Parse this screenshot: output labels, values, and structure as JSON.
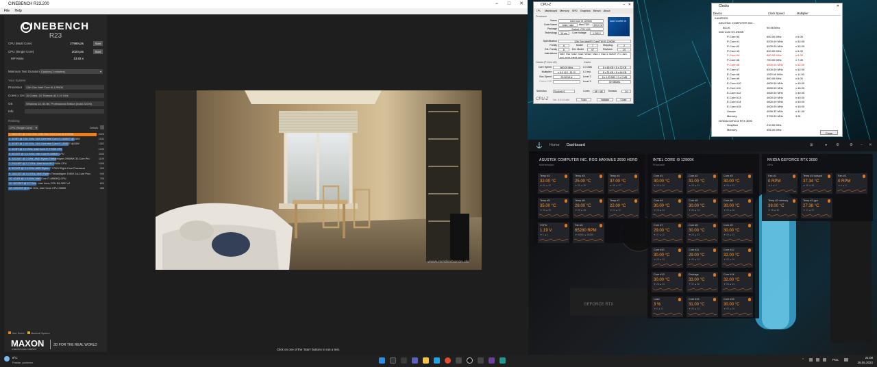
{
  "cinebench": {
    "window_title": "CINEBENCH R23.200",
    "menu": [
      "File",
      "Help"
    ],
    "logo_line1": "CINEBENCH",
    "logo_line2": "R23",
    "multi_label": "CPU (Multi Core)",
    "multi_value": "27989 pts",
    "single_label": "CPU (Single Core)",
    "single_value": "2023 pts",
    "mp_label": "MP Ratio",
    "mp_value": "13.83 x",
    "start_label": "Start",
    "min_test_label": "Minimum Test Duration",
    "min_test_value": "Custom (1 minutes)",
    "your_system": "Your System",
    "processor_label": "Processor",
    "processor_value": "12th Gen Intel Core i9-12900K",
    "cores_label": "Cores x GHz",
    "cores_value": "16 Cores, 24 Threads @ 3.19 GHz",
    "os_label": "OS",
    "os_value": "Windows 10, 64 Bit, Professional Edition (build 22000)",
    "info_label": "Info",
    "ranking_label": "Ranking",
    "ranking_select": "CPU (Single Core)",
    "details_label": "Details",
    "ranking": [
      {
        "text": "1. 16C/24T @ 3.19 GHz, 12th Gen Intel Core i9-12900K",
        "score": "2023",
        "pct": 100,
        "hi": true
      },
      {
        "text": "2. 4C/8T @ 2.61 GHz, 11th Gen Intel Core i7-1165G7 @ 28W",
        "score": "1532",
        "pct": 75
      },
      {
        "text": "3. 4C/8T @ 1.69 GHz, 11th Gen Intel Core i7-1165G7 @15W",
        "score": "1382",
        "pct": 68
      },
      {
        "text": "4. 4C/8T @ 4.2 GHz, Intel Core i7-7700K CPU",
        "score": "1230",
        "pct": 61
      },
      {
        "text": "5. 8C/16T @ 2.3 GHz, Intel Core i9-9880H CPU",
        "score": "1183",
        "pct": 58
      },
      {
        "text": "6. 32C/64T @ 3 GHz, AMD Ryzen Threadripper 2990WX 32-Core Pro",
        "score": "1109",
        "pct": 54
      },
      {
        "text": "7. 24C/48T @ 2.7 GHz, Intel Xeon W-2265M CPU",
        "score": "1058",
        "pct": 52
      },
      {
        "text": "8. 8C/16T @ 3.4 GHz, AMD Ryzen 7 1700X Eight-Core Processor",
        "score": "959",
        "pct": 47
      },
      {
        "text": "9. 16C/32T @ 3.4 GHz, AMD Ryzen Threadripper 1950X 16-Core Proc",
        "score": "945",
        "pct": 46
      },
      {
        "text": "10. 4C/8T @ 2.3 GHz, Intel Core i7-4850HQ CPU",
        "score": "750",
        "pct": 37
      },
      {
        "text": "11. 12C/24T @ 2.7 GHz, Intel Xeon CPU E5-2697 v2",
        "score": "653",
        "pct": 32
      },
      {
        "text": "12. 12C/24T @ 2.66 GHz, Intel Xeon CPU X5650",
        "score": "486",
        "pct": 24
      }
    ],
    "legend_your": "Your Score",
    "legend_identical": "Identical System",
    "maxon_brand": "MAXON",
    "maxon_sub": "A NEMETSCHEK COMPANY",
    "maxon_tag": "3D FOR THE REAL WORLD",
    "status": "Click on one of the 'Start' buttons to run a test.",
    "watermark": "www.renderbaron.de"
  },
  "cpuz": {
    "title": "CPU-Z",
    "tabs": [
      "CPU",
      "Mainboard",
      "Memory",
      "SPD",
      "Graphics",
      "Bench",
      "About"
    ],
    "processor": "Processor",
    "name_l": "Name",
    "name_v": "Intel Core i9 12900K",
    "code_l": "Code Name",
    "code_v": "Alder Lake",
    "tdp_l": "Max TDP",
    "tdp_v": "125.0 W",
    "pkg_l": "Package",
    "pkg_v": "Socket 1700 LGA",
    "tech_l": "Technology",
    "tech_v": "10 nm",
    "volt_l": "Core Voltage",
    "volt_v": "1.290 V",
    "spec_l": "Specification",
    "spec_v": "12th Gen Intel(R) Core(TM) i9-12900K",
    "fam_l": "Family",
    "fam_v": "6",
    "model_l": "Model",
    "model_v": "7",
    "step_l": "Stepping",
    "step_v": "2",
    "efam_l": "Ext. Family",
    "efam_v": "6",
    "emodel_l": "Ext. Model",
    "emodel_v": "97",
    "rev_l": "Revision",
    "rev_v": "C0",
    "instr_l": "Instructions",
    "instr_v": "MMX, SSE, SSE2, SSE3, SSSE3, SSE4.1, SSE4.2, EM64T, VT-x, AES, AVX, AVX2, FMA3, SHA",
    "clocks": "Clocks (P-Core #0)",
    "cache": "Cache",
    "cs_l": "Core Speed",
    "cs_v": "600.00 MHz",
    "mul_l": "Multiplier",
    "mul_v": "x 6.0 (4.0 - 51.0)",
    "bus_l": "Bus Speed",
    "bus_v": "99.98 MHz",
    "fsb_l": "Rated FSB",
    "l1d_l": "L1 Data",
    "l1d_v": "8 x 48 KB + 8 x 32 KB",
    "l1i_l": "L1 Inst.",
    "l1i_v": "8 x 32 KB + 8 x 64 KB",
    "l2_l": "Level 2",
    "l2_v": "8 x 1.25 MB + 2 x 2 MB",
    "l3_l": "Level 3",
    "l3_v": "30 MBytes",
    "sel_l": "Selection",
    "sel_v": "Socket #1",
    "cores_l": "Cores",
    "cores_v": "8P + 8E",
    "thr_l": "Threads",
    "thr_v": "24",
    "brand": "CPU-Z",
    "ver": "Ver. 2.01.0.x64",
    "tools": "Tools",
    "validate": "Validate",
    "close": "Close",
    "intel_badge": "intel CORE i9"
  },
  "hwinfo": {
    "title": "Clocks",
    "col_device": "Device",
    "col_clock": "Clock Speed",
    "col_mult": "Multiplier",
    "rows": [
      {
        "n": "KAMPERS",
        "c": "",
        "m": "",
        "lvl": 0
      },
      {
        "n": "ASUSTeK COMPUTER INC...",
        "c": "",
        "m": "",
        "lvl": 1
      },
      {
        "n": "BCLK",
        "c": "99.98 MHz",
        "m": "",
        "lvl": 2
      },
      {
        "n": "Intel Core i9 12900K",
        "c": "",
        "m": "",
        "lvl": 1
      },
      {
        "n": "P-Core #0",
        "c": "600.00 MHz",
        "m": "x 6.00",
        "lvl": 3
      },
      {
        "n": "P-Core #1",
        "c": "5200.00 MHz",
        "m": "x 52.00",
        "lvl": 3
      },
      {
        "n": "P-Core #2",
        "c": "5200.00 MHz",
        "m": "x 52.00",
        "lvl": 3
      },
      {
        "n": "P-Core #3",
        "c": "600.00 MHz",
        "m": "x 6.00",
        "lvl": 3
      },
      {
        "n": "P-Core #4",
        "c": "600.00 MHz",
        "m": "x 6.00",
        "lvl": 3,
        "red": true
      },
      {
        "n": "P-Core #5",
        "c": "700.00 MHz",
        "m": "x 7.00",
        "lvl": 3
      },
      {
        "n": "P-Core #6",
        "c": "5200.00 MHz",
        "m": "x 52.00",
        "lvl": 3,
        "red": true
      },
      {
        "n": "P-Core #7",
        "c": "5200.00 MHz",
        "m": "x 52.00",
        "lvl": 3
      },
      {
        "n": "E-Core #8",
        "c": "1100.00 MHz",
        "m": "x 11.00",
        "lvl": 3
      },
      {
        "n": "E-Core #9",
        "c": "800.00 MHz",
        "m": "x 8.00",
        "lvl": 3
      },
      {
        "n": "E-Core #10",
        "c": "4000.00 MHz",
        "m": "x 40.00",
        "lvl": 3
      },
      {
        "n": "E-Core #11",
        "c": "4000.00 MHz",
        "m": "x 40.00",
        "lvl": 3
      },
      {
        "n": "E-Core #12",
        "c": "4000.00 MHz",
        "m": "x 40.00",
        "lvl": 3
      },
      {
        "n": "E-Core #13",
        "c": "4000.00 MHz",
        "m": "x 40.00",
        "lvl": 3
      },
      {
        "n": "E-Core #14",
        "c": "4000.00 MHz",
        "m": "x 40.00",
        "lvl": 3
      },
      {
        "n": "E-Core #15",
        "c": "4000.00 MHz",
        "m": "x 40.00",
        "lvl": 3
      },
      {
        "n": "Uncore",
        "c": "4099.32 MHz",
        "m": "x 41.00",
        "lvl": 3
      },
      {
        "n": "Memory",
        "c": "3700.00 MHz",
        "m": "1:31",
        "lvl": 3
      },
      {
        "n": "NVIDIA GeForce RTX 3090",
        "c": "",
        "m": "",
        "lvl": 1
      },
      {
        "n": "Graphics",
        "c": "210.00 MHz",
        "m": "",
        "lvl": 3
      },
      {
        "n": "Memory",
        "c": "405.00 MHz",
        "m": "",
        "lvl": 3
      }
    ],
    "close": "Close"
  },
  "icue": {
    "home": "Home",
    "dashboard": "Dashboard",
    "panels": [
      {
        "title": "ASUSTEK COMPUTER INC. ROG MAXIMUS Z690 HERO",
        "sub": "Motherboard"
      },
      {
        "title": "INTEL CORE I9 12900K",
        "sub": "Processor"
      },
      {
        "title": "NVIDIA GEFORCE RTX 3090",
        "sub": "GPU"
      }
    ],
    "mb_tiles": [
      {
        "l": "Temp #2",
        "v": "32.00 °C",
        "mm": "▼ 32  ▲ 32"
      },
      {
        "l": "Temp #3",
        "v": "25.00 °C",
        "mm": "▼ 25  ▲ 26"
      },
      {
        "l": "Temp #4",
        "v": "37.00 °C",
        "mm": "▼ 36  ▲ 37"
      },
      {
        "l": "Temp #5",
        "v": "35.00 °C",
        "mm": "▼ 35  ▲ 35"
      },
      {
        "l": "Temp #6",
        "v": "28.00 °C",
        "mm": "▼ 28  ▲ 28"
      },
      {
        "l": "Temp #7",
        "v": "22.00 °C",
        "mm": "▼ 22  ▲ 22"
      },
      {
        "l": "VCPU",
        "v": "1.19 V",
        "mm": "▼ 1  ▲ 1"
      },
      {
        "l": "Fan #1",
        "v": "65280 RPM",
        "mm": "▼ 65280  ▲ 65280"
      }
    ],
    "cpu_tiles": [
      {
        "l": "Core #1",
        "v": "30.00 °C",
        "mm": "▼ 29  ▲ 34"
      },
      {
        "l": "Core #2",
        "v": "31.00 °C",
        "mm": "▼ 28  ▲ 34"
      },
      {
        "l": "Core #3",
        "v": "30.00 °C",
        "mm": "▼ 28  ▲ 33"
      },
      {
        "l": "Core #4",
        "v": "30.00 °C",
        "mm": "▼ 28  ▲ 34"
      },
      {
        "l": "Core #5",
        "v": "30.00 °C",
        "mm": "▼ 28  ▲ 34"
      },
      {
        "l": "Core #6",
        "v": "30.00 °C",
        "mm": "▼ 28  ▲ 34"
      },
      {
        "l": "Core #7",
        "v": "29.00 °C",
        "mm": "▼ 27  ▲ 32"
      },
      {
        "l": "Core #8",
        "v": "30.00 °C",
        "mm": "▼ 28  ▲ 33"
      },
      {
        "l": "Core #9",
        "v": "30.00 °C",
        "mm": "▼ 28  ▲ 33"
      },
      {
        "l": "Core #10",
        "v": "30.00 °C",
        "mm": "▼ 28  ▲ 33"
      },
      {
        "l": "Core #11",
        "v": "29.00 °C",
        "mm": "▼ 28  ▲ 32"
      },
      {
        "l": "Core #12",
        "v": "32.00 °C",
        "mm": "▼ 28  ▲ 34"
      },
      {
        "l": "Core #13",
        "v": "30.00 °C",
        "mm": "▼ 28  ▲ 34"
      },
      {
        "l": "Package",
        "v": "33.00 °C",
        "mm": "▼ 32  ▲ 36"
      },
      {
        "l": "Core #14",
        "v": "32.00 °C",
        "mm": "▼ 28  ▲ 34"
      },
      {
        "l": "Load",
        "v": "3 %",
        "mm": "▼ 0  ▲ 11"
      },
      {
        "l": "Core #15",
        "v": "31.00 °C",
        "mm": "▼ 28  ▲ 32"
      },
      {
        "l": "Core #16",
        "v": "30.00 °C",
        "mm": "▼ 28  ▲ 34"
      }
    ],
    "gpu_tiles": [
      {
        "l": "Fan #1",
        "v": "0 RPM",
        "mm": "▼ 0  ▲ 0"
      },
      {
        "l": "Temp #3 hotspot",
        "v": "37.34 °C",
        "mm": "▼ 36  ▲ 38"
      },
      {
        "l": "Fan #2",
        "v": "0 RPM",
        "mm": "▼ 0  ▲ 0"
      },
      {
        "l": "Temp #2 memory",
        "v": "38.00 °C",
        "mm": "▼ 38  ▲ 38"
      },
      {
        "l": "Temp #1 gpu",
        "v": "27.38 °C",
        "mm": "▼ 27  ▲ 28"
      }
    ]
  },
  "taskbar": {
    "weather_temp": "9°C",
    "weather_text": "Prawie, pochmur.",
    "lang": "POL",
    "time": "21:08",
    "date": "26.05.2022"
  }
}
